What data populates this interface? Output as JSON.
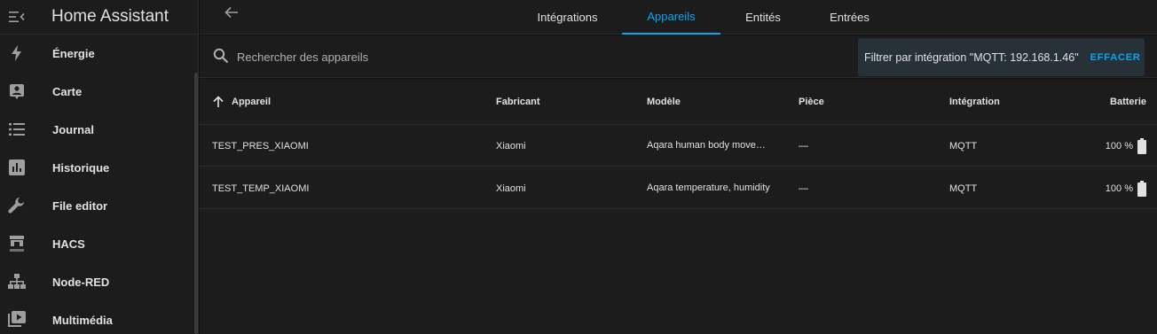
{
  "app": {
    "title": "Home Assistant"
  },
  "sidebar": {
    "items": [
      {
        "label": "Énergie",
        "icon": "lightning-bolt-icon"
      },
      {
        "label": "Carte",
        "icon": "map-account-icon"
      },
      {
        "label": "Journal",
        "icon": "format-list-bulleted-icon"
      },
      {
        "label": "Historique",
        "icon": "chart-box-icon"
      },
      {
        "label": "File editor",
        "icon": "wrench-icon"
      },
      {
        "label": "HACS",
        "icon": "hacs-icon"
      },
      {
        "label": "Node-RED",
        "icon": "sitemap-icon"
      },
      {
        "label": "Multimédia",
        "icon": "play-box-multiple-icon"
      }
    ]
  },
  "tabs": [
    {
      "label": "Intégrations",
      "active": false
    },
    {
      "label": "Appareils",
      "active": true
    },
    {
      "label": "Entités",
      "active": false
    },
    {
      "label": "Entrées",
      "active": false
    }
  ],
  "search": {
    "placeholder": "Rechercher des appareils",
    "value": ""
  },
  "filter": {
    "text": "Filtrer par intégration \"MQTT: 192.168.1.46\"",
    "clear_label": "EFFACER"
  },
  "table": {
    "columns": [
      "Appareil",
      "Fabricant",
      "Modèle",
      "Pièce",
      "Intégration",
      "Batterie"
    ],
    "rows": [
      {
        "device": "TEST_PRES_XIAOMI",
        "manufacturer": "Xiaomi",
        "model": "Aqara human body movement",
        "area": "—",
        "integration": "MQTT",
        "battery": "100 %"
      },
      {
        "device": "TEST_TEMP_XIAOMI",
        "manufacturer": "Xiaomi",
        "model": "Aqara temperature, humidity",
        "area": "—",
        "integration": "MQTT",
        "battery": "100 %"
      }
    ]
  },
  "colors": {
    "accent": "#03a9f4",
    "sidebar_bg": "#1c1c1c",
    "page_bg": "#111111",
    "chip_bg": "#273238"
  }
}
